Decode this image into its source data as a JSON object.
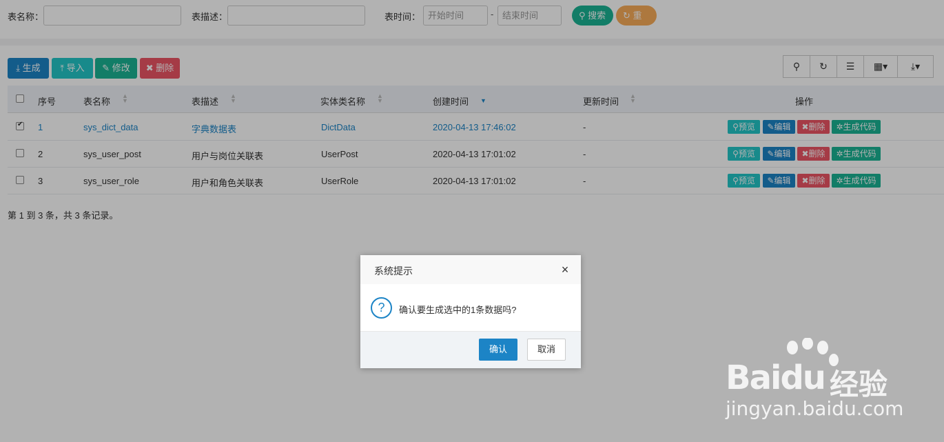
{
  "search": {
    "table_name_label": "表名称：",
    "table_desc_label": "表描述：",
    "table_time_label": "表时间：",
    "start_placeholder": "开始时间",
    "end_placeholder": "结束时间",
    "range_dash": "-",
    "search_button": "搜索",
    "reset_button": "重置"
  },
  "toolbar": {
    "generate": "生成",
    "import": "导入",
    "modify": "修改",
    "delete": "删除"
  },
  "table": {
    "headers": {
      "index": "序号",
      "table_name": "表名称",
      "table_desc": "表描述",
      "entity_name": "实体类名称",
      "create_time": "创建时间",
      "update_time": "更新时间",
      "actions": "操作"
    },
    "rows": [
      {
        "checked": true,
        "index": "1",
        "table_name": "sys_dict_data",
        "table_desc": "字典数据表",
        "entity_name": "DictData",
        "create_time": "2020-04-13 17:46:02",
        "update_time": "-"
      },
      {
        "checked": false,
        "index": "2",
        "table_name": "sys_user_post",
        "table_desc": "用户与岗位关联表",
        "entity_name": "UserPost",
        "create_time": "2020-04-13 17:01:02",
        "update_time": "-"
      },
      {
        "checked": false,
        "index": "3",
        "table_name": "sys_user_role",
        "table_desc": "用户和角色关联表",
        "entity_name": "UserRole",
        "create_time": "2020-04-13 17:01:02",
        "update_time": "-"
      }
    ],
    "row_actions": {
      "preview": "预览",
      "edit": "编辑",
      "delete": "删除",
      "generate_code": "生成代码"
    }
  },
  "pagination": {
    "summary": "第 1 到 3 条，共 3 条记录。"
  },
  "dialog": {
    "title": "系统提示",
    "message": "确认要生成选中的1条数据吗?",
    "confirm": "确认",
    "cancel": "取消"
  },
  "watermark": {
    "brand": "Bai",
    "brand_du": "du",
    "suffix": "经验",
    "url": "jingyan.baidu.com"
  },
  "colors": {
    "primary": "#1c84c6",
    "info": "#23c6c8",
    "success": "#1ab394",
    "danger": "#ed5565",
    "warning": "#f8ac59"
  }
}
